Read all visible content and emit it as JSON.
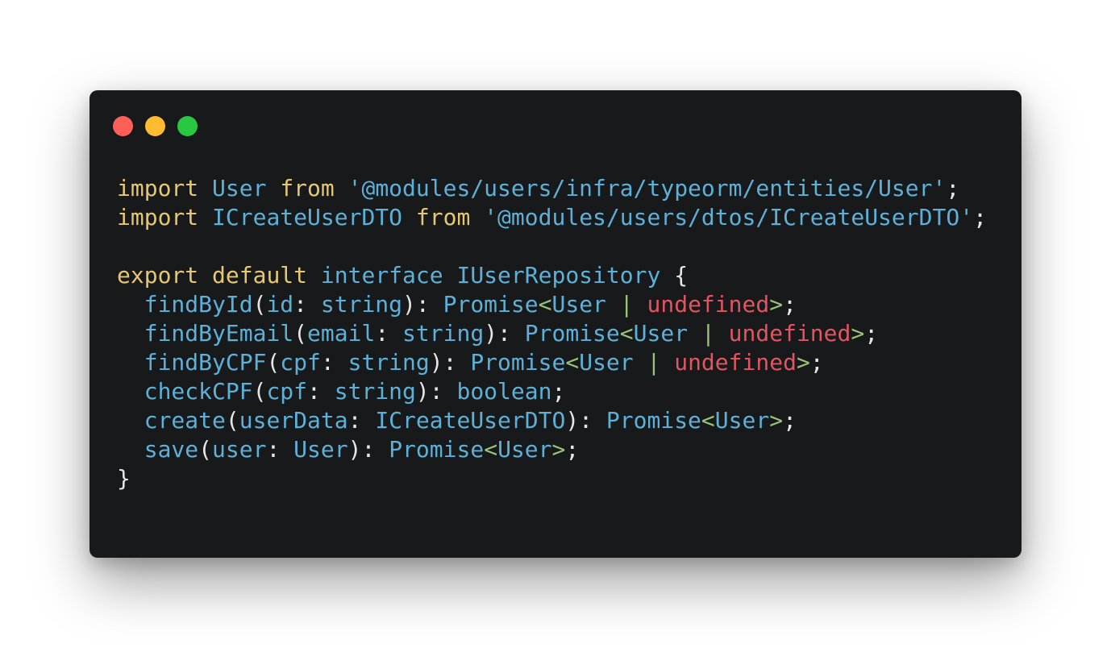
{
  "colors": {
    "background": "#ffffff",
    "window": "#18191b",
    "keyword": "#e6c872",
    "identifier": "#5db0d7",
    "punctuation": "#e6e6e6",
    "angle": "#98c379",
    "literal": "#e05561"
  },
  "window_controls": [
    {
      "name": "close",
      "color": "#ff5f57"
    },
    {
      "name": "minimize",
      "color": "#febc2e"
    },
    {
      "name": "maximize",
      "color": "#28c840"
    }
  ],
  "code": {
    "language": "typescript",
    "lines": [
      [
        {
          "text": "import",
          "type": "keyword"
        },
        {
          "text": " ",
          "type": "plain"
        },
        {
          "text": "User",
          "type": "identifier"
        },
        {
          "text": " ",
          "type": "plain"
        },
        {
          "text": "from",
          "type": "keyword"
        },
        {
          "text": " ",
          "type": "plain"
        },
        {
          "text": "'@modules/users/infra/typeorm/entities/User'",
          "type": "identifier"
        },
        {
          "text": ";",
          "type": "punctuation"
        }
      ],
      [
        {
          "text": "import",
          "type": "keyword"
        },
        {
          "text": " ",
          "type": "plain"
        },
        {
          "text": "ICreateUserDTO",
          "type": "identifier"
        },
        {
          "text": " ",
          "type": "plain"
        },
        {
          "text": "from",
          "type": "keyword"
        },
        {
          "text": " ",
          "type": "plain"
        },
        {
          "text": "'@modules/users/dtos/ICreateUserDTO'",
          "type": "identifier"
        },
        {
          "text": ";",
          "type": "punctuation"
        }
      ],
      [],
      [
        {
          "text": "export",
          "type": "keyword"
        },
        {
          "text": " ",
          "type": "plain"
        },
        {
          "text": "default",
          "type": "keyword"
        },
        {
          "text": " ",
          "type": "plain"
        },
        {
          "text": "interface",
          "type": "identifier"
        },
        {
          "text": " ",
          "type": "plain"
        },
        {
          "text": "IUserRepository",
          "type": "identifier"
        },
        {
          "text": " ",
          "type": "plain"
        },
        {
          "text": "{",
          "type": "punctuation"
        }
      ],
      [
        {
          "text": "  ",
          "type": "plain"
        },
        {
          "text": "findById",
          "type": "identifier"
        },
        {
          "text": "(",
          "type": "punctuation"
        },
        {
          "text": "id",
          "type": "identifier"
        },
        {
          "text": ": ",
          "type": "punctuation"
        },
        {
          "text": "string",
          "type": "identifier"
        },
        {
          "text": "): ",
          "type": "punctuation"
        },
        {
          "text": "Promise",
          "type": "identifier"
        },
        {
          "text": "<",
          "type": "angle"
        },
        {
          "text": "User",
          "type": "identifier"
        },
        {
          "text": " ",
          "type": "plain"
        },
        {
          "text": "|",
          "type": "angle"
        },
        {
          "text": " ",
          "type": "plain"
        },
        {
          "text": "undefined",
          "type": "literal"
        },
        {
          "text": ">",
          "type": "angle"
        },
        {
          "text": ";",
          "type": "punctuation"
        }
      ],
      [
        {
          "text": "  ",
          "type": "plain"
        },
        {
          "text": "findByEmail",
          "type": "identifier"
        },
        {
          "text": "(",
          "type": "punctuation"
        },
        {
          "text": "email",
          "type": "identifier"
        },
        {
          "text": ": ",
          "type": "punctuation"
        },
        {
          "text": "string",
          "type": "identifier"
        },
        {
          "text": "): ",
          "type": "punctuation"
        },
        {
          "text": "Promise",
          "type": "identifier"
        },
        {
          "text": "<",
          "type": "angle"
        },
        {
          "text": "User",
          "type": "identifier"
        },
        {
          "text": " ",
          "type": "plain"
        },
        {
          "text": "|",
          "type": "angle"
        },
        {
          "text": " ",
          "type": "plain"
        },
        {
          "text": "undefined",
          "type": "literal"
        },
        {
          "text": ">",
          "type": "angle"
        },
        {
          "text": ";",
          "type": "punctuation"
        }
      ],
      [
        {
          "text": "  ",
          "type": "plain"
        },
        {
          "text": "findByCPF",
          "type": "identifier"
        },
        {
          "text": "(",
          "type": "punctuation"
        },
        {
          "text": "cpf",
          "type": "identifier"
        },
        {
          "text": ": ",
          "type": "punctuation"
        },
        {
          "text": "string",
          "type": "identifier"
        },
        {
          "text": "): ",
          "type": "punctuation"
        },
        {
          "text": "Promise",
          "type": "identifier"
        },
        {
          "text": "<",
          "type": "angle"
        },
        {
          "text": "User",
          "type": "identifier"
        },
        {
          "text": " ",
          "type": "plain"
        },
        {
          "text": "|",
          "type": "angle"
        },
        {
          "text": " ",
          "type": "plain"
        },
        {
          "text": "undefined",
          "type": "literal"
        },
        {
          "text": ">",
          "type": "angle"
        },
        {
          "text": ";",
          "type": "punctuation"
        }
      ],
      [
        {
          "text": "  ",
          "type": "plain"
        },
        {
          "text": "checkCPF",
          "type": "identifier"
        },
        {
          "text": "(",
          "type": "punctuation"
        },
        {
          "text": "cpf",
          "type": "identifier"
        },
        {
          "text": ": ",
          "type": "punctuation"
        },
        {
          "text": "string",
          "type": "identifier"
        },
        {
          "text": "): ",
          "type": "punctuation"
        },
        {
          "text": "boolean",
          "type": "identifier"
        },
        {
          "text": ";",
          "type": "punctuation"
        }
      ],
      [
        {
          "text": "  ",
          "type": "plain"
        },
        {
          "text": "create",
          "type": "identifier"
        },
        {
          "text": "(",
          "type": "punctuation"
        },
        {
          "text": "userData",
          "type": "identifier"
        },
        {
          "text": ": ",
          "type": "punctuation"
        },
        {
          "text": "ICreateUserDTO",
          "type": "identifier"
        },
        {
          "text": "): ",
          "type": "punctuation"
        },
        {
          "text": "Promise",
          "type": "identifier"
        },
        {
          "text": "<",
          "type": "angle"
        },
        {
          "text": "User",
          "type": "identifier"
        },
        {
          "text": ">",
          "type": "angle"
        },
        {
          "text": ";",
          "type": "punctuation"
        }
      ],
      [
        {
          "text": "  ",
          "type": "plain"
        },
        {
          "text": "save",
          "type": "identifier"
        },
        {
          "text": "(",
          "type": "punctuation"
        },
        {
          "text": "user",
          "type": "identifier"
        },
        {
          "text": ": ",
          "type": "punctuation"
        },
        {
          "text": "User",
          "type": "identifier"
        },
        {
          "text": "): ",
          "type": "punctuation"
        },
        {
          "text": "Promise",
          "type": "identifier"
        },
        {
          "text": "<",
          "type": "angle"
        },
        {
          "text": "User",
          "type": "identifier"
        },
        {
          "text": ">",
          "type": "angle"
        },
        {
          "text": ";",
          "type": "punctuation"
        }
      ],
      [
        {
          "text": "}",
          "type": "punctuation"
        }
      ]
    ]
  }
}
